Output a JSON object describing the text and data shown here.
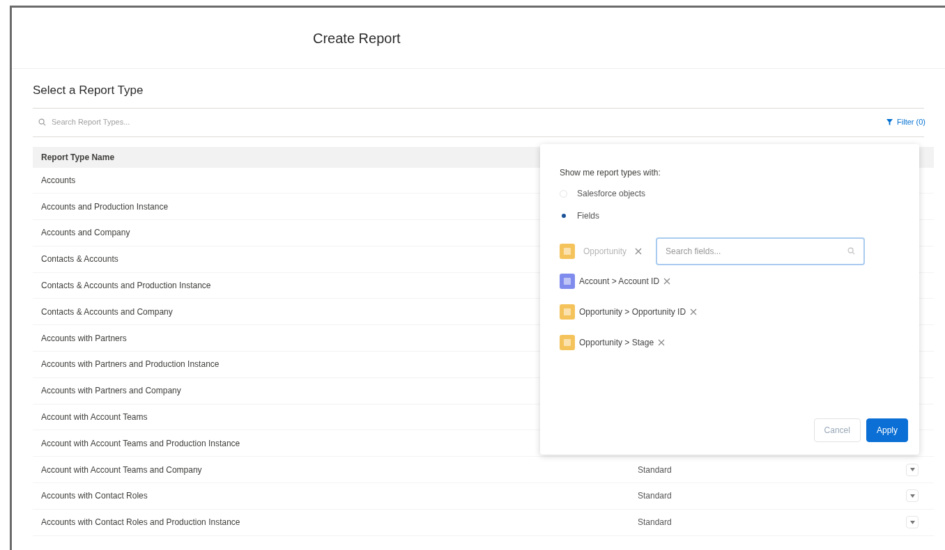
{
  "modal": {
    "title": "Create Report"
  },
  "section_title": "Select a Report Type",
  "search": {
    "placeholder": "Search Report Types..."
  },
  "filter_button": {
    "label": "Filter (0)"
  },
  "table": {
    "columns": [
      "Report Type Name"
    ],
    "rows": [
      {
        "name": "Accounts"
      },
      {
        "name": "Accounts and Production Instance"
      },
      {
        "name": "Accounts and Company"
      },
      {
        "name": "Contacts & Accounts"
      },
      {
        "name": "Contacts & Accounts and Production Instance"
      },
      {
        "name": "Contacts & Accounts and Company"
      },
      {
        "name": "Accounts with Partners"
      },
      {
        "name": "Accounts with Partners and Production Instance"
      },
      {
        "name": "Accounts with Partners and Company"
      },
      {
        "name": "Account with Account Teams"
      },
      {
        "name": "Account with Account Teams and Production Instance"
      },
      {
        "name": "Account with Account Teams and Company",
        "category": "Standard"
      },
      {
        "name": "Accounts with Contact Roles",
        "category": "Standard"
      },
      {
        "name": "Accounts with Contact Roles and Production Instance",
        "category": "Standard"
      }
    ]
  },
  "filter_popover": {
    "heading": "Show me report types with:",
    "options": [
      {
        "label": "Salesforce objects",
        "selected": false
      },
      {
        "label": "Fields",
        "selected": true
      }
    ],
    "object_chip": {
      "label": "Opportunity",
      "color": "#f5c35b"
    },
    "field_search": {
      "placeholder": "Search fields..."
    },
    "field_chips": [
      {
        "label": "Account > Account ID",
        "color": "#7f8ced"
      },
      {
        "label": "Opportunity > Opportunity ID",
        "color": "#f5c35b"
      },
      {
        "label": "Opportunity > Stage",
        "color": "#f5c35b"
      }
    ],
    "buttons": [
      {
        "label": "Cancel",
        "kind": "secondary"
      },
      {
        "label": "Apply",
        "kind": "primary"
      }
    ]
  }
}
